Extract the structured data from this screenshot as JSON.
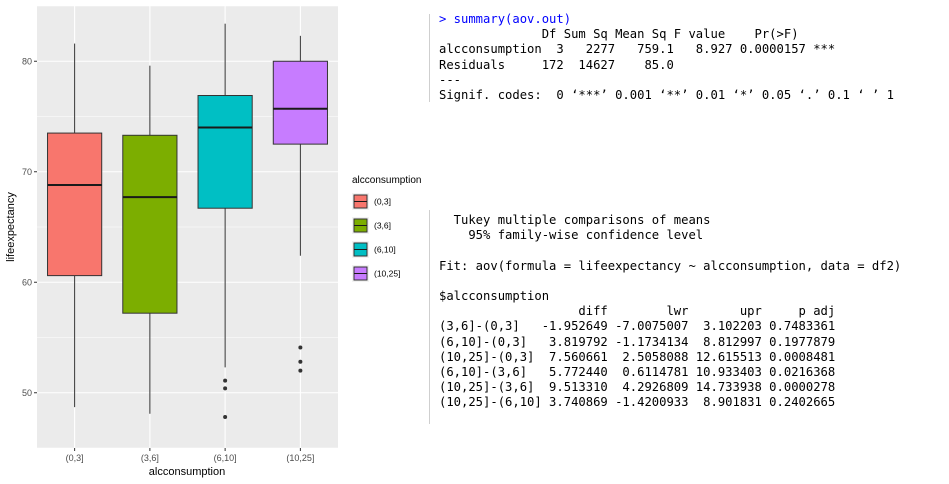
{
  "chart_data": {
    "type": "boxplot",
    "xlabel": "alcconsumption",
    "ylabel": "lifeexpectancy",
    "categories": [
      "(0,3]",
      "(3,6]",
      "(6,10]",
      "(10,25]"
    ],
    "ylim": [
      45,
      85
    ],
    "yticks": [
      50,
      60,
      70,
      80
    ],
    "grid": true,
    "legend": {
      "title": "alcconsumption",
      "position": "right"
    },
    "series": [
      {
        "name": "(0,3]",
        "color": "#F8766D",
        "whisker_low": 48.7,
        "q1": 60.6,
        "median": 68.8,
        "q3": 73.5,
        "whisker_high": 81.6,
        "outliers": []
      },
      {
        "name": "(3,6]",
        "color": "#7CAE00",
        "whisker_low": 48.1,
        "q1": 57.2,
        "median": 67.7,
        "q3": 73.3,
        "whisker_high": 79.6,
        "outliers": []
      },
      {
        "name": "(6,10]",
        "color": "#00BFC4",
        "whisker_low": 52.3,
        "q1": 66.7,
        "median": 74.0,
        "q3": 76.9,
        "whisker_high": 83.4,
        "outliers": [
          51.1,
          50.4,
          47.8
        ]
      },
      {
        "name": "(10,25]",
        "color": "#C77CFF",
        "whisker_low": 62.4,
        "q1": 72.5,
        "median": 75.7,
        "q3": 80.0,
        "whisker_high": 82.3,
        "outliers": [
          54.1,
          52.8,
          52.0
        ]
      }
    ]
  },
  "console": {
    "aov": [
      "> summary(aov.out)",
      "              Df Sum Sq Mean Sq F value    Pr(>F)    ",
      "alcconsumption  3   2277   759.1   8.927 0.0000157 ***",
      "Residuals     172  14627    85.0                      ",
      "---",
      "Signif. codes:  0 ‘***’ 0.001 ‘**’ 0.01 ‘*’ 0.05 ‘.’ 0.1 ‘ ’ 1"
    ],
    "tukey": [
      "  Tukey multiple comparisons of means",
      "    95% family-wise confidence level",
      "",
      "Fit: aov(formula = lifeexpectancy ~ alcconsumption, data = df2)",
      "",
      "$alcconsumption",
      "                   diff        lwr       upr     p adj",
      "(3,6]-(0,3]   -1.952649 -7.0075007  3.102203 0.7483361",
      "(6,10]-(0,3]   3.819792 -1.1734134  8.812997 0.1977879",
      "(10,25]-(0,3]  7.560661  2.5058088 12.615513 0.0008481",
      "(6,10]-(3,6]   5.772440  0.6114781 10.933403 0.0216368",
      "(10,25]-(3,6]  9.513310  4.2926809 14.733938 0.0000278",
      "(10,25]-(6,10] 3.740869 -1.4200933  8.901831 0.2402665"
    ]
  }
}
